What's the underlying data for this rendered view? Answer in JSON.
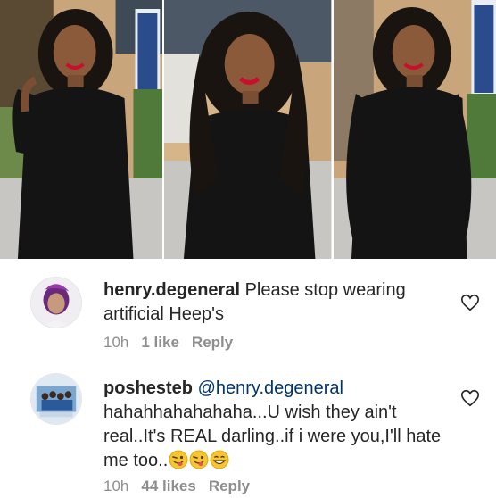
{
  "comments": [
    {
      "username": "henry.degeneral",
      "text": "Please stop wearing artificial Heep's",
      "time": "10h",
      "likes": "1 like",
      "reply_label": "Reply"
    },
    {
      "username": "poshesteb",
      "mention": "@henry.degeneral",
      "text": "hahahhahahahaha...U wish they ain't real..It's REAL darling..if i were you,I'll hate me too..",
      "emojis": [
        "winking-tongue-face-icon",
        "winking-tongue-face-icon",
        "grinning-face-icon"
      ],
      "time": "10h",
      "likes": "44 likes",
      "reply_label": "Reply"
    }
  ],
  "colors": {
    "text": "#262626",
    "meta": "#8e8e8e",
    "mention": "#003569",
    "dress": "#141414",
    "lips": "#c8102e"
  }
}
